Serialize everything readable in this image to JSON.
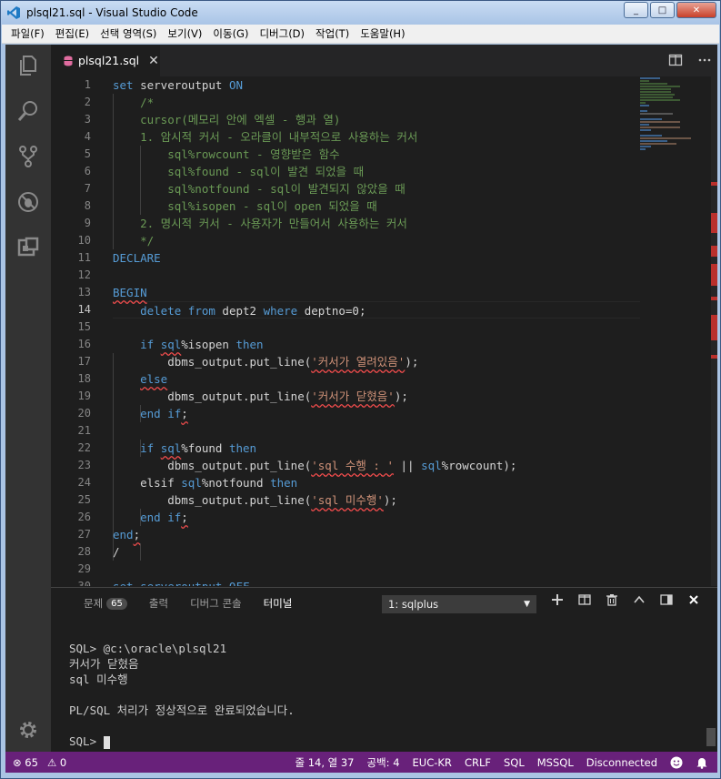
{
  "window": {
    "title": "plsql21.sql - Visual Studio Code",
    "minimize": "_",
    "maximize": "□",
    "close": "✕"
  },
  "menu": [
    "파일(F)",
    "편집(E)",
    "선택 영역(S)",
    "보기(V)",
    "이동(G)",
    "디버그(D)",
    "작업(T)",
    "도움말(H)"
  ],
  "tab": {
    "label": "plsql21.sql",
    "close": "✕"
  },
  "colors": {
    "statusbar": "#68217a",
    "keyword": "#569cd6",
    "comment": "#6a9955",
    "string": "#ce9178",
    "error": "#f14c4c"
  },
  "icons": [
    "explorer-icon",
    "search-icon",
    "source-control-icon",
    "debug-icon",
    "extensions-icon",
    "gear-icon"
  ],
  "line_numbers": [
    "1",
    "2",
    "3",
    "4",
    "5",
    "6",
    "7",
    "8",
    "9",
    "10",
    "11",
    "12",
    "13",
    "14",
    "15",
    "16",
    "17",
    "18",
    "19",
    "20",
    "21",
    "22",
    "23",
    "24",
    "25",
    "26",
    "27",
    "28",
    "29",
    "30"
  ],
  "code": [
    [
      {
        "t": "set ",
        "c": "kw"
      },
      {
        "t": "serveroutput "
      },
      {
        "t": "ON",
        "c": "kw"
      }
    ],
    [
      {
        "t": "    /*",
        "c": "cm"
      }
    ],
    [
      {
        "t": "    cursor(메모리 안에 엑셀 - 행과 열)",
        "c": "cm"
      }
    ],
    [
      {
        "t": "    1. 암시적 커서 - 오라클이 내부적으로 사용하는 커서",
        "c": "cm"
      }
    ],
    [
      {
        "t": "        sql%rowcount - 영향받은 함수",
        "c": "cm"
      }
    ],
    [
      {
        "t": "        sql%found - sql이 발견 되었을 때",
        "c": "cm"
      }
    ],
    [
      {
        "t": "        sql%notfound - sql이 발견되지 않았을 때",
        "c": "cm"
      }
    ],
    [
      {
        "t": "        sql%isopen - sql이 open 되었을 때",
        "c": "cm"
      }
    ],
    [
      {
        "t": "    2. 명시적 커서 - 사용자가 만들어서 사용하는 커서",
        "c": "cm"
      }
    ],
    [
      {
        "t": "    */",
        "c": "cm"
      }
    ],
    [
      {
        "t": "DECLARE",
        "c": "kw"
      }
    ],
    [
      {
        "t": ""
      }
    ],
    [
      {
        "t": "BEGIN",
        "c": "kw sq"
      }
    ],
    [
      {
        "t": "    "
      },
      {
        "t": "delete from ",
        "c": "kw"
      },
      {
        "t": "dept2 "
      },
      {
        "t": "where ",
        "c": "kw"
      },
      {
        "t": "deptno=0;"
      }
    ],
    [
      {
        "t": ""
      }
    ],
    [
      {
        "t": "    "
      },
      {
        "t": "if ",
        "c": "kw"
      },
      {
        "t": "sql",
        "c": "kw sq"
      },
      {
        "t": "%isopen "
      },
      {
        "t": "then",
        "c": "kw"
      }
    ],
    [
      {
        "t": "        dbms_output.put_line("
      },
      {
        "t": "'커서가 열려있음'",
        "c": "st sq"
      },
      {
        "t": ");"
      }
    ],
    [
      {
        "t": "    "
      },
      {
        "t": "else",
        "c": "kw sq"
      }
    ],
    [
      {
        "t": "        dbms_output.put_line("
      },
      {
        "t": "'커서가 닫혔음'",
        "c": "st sq"
      },
      {
        "t": ");"
      }
    ],
    [
      {
        "t": "    "
      },
      {
        "t": "end if",
        "c": "kw"
      },
      {
        "t": ";",
        "c": "sq"
      }
    ],
    [
      {
        "t": ""
      }
    ],
    [
      {
        "t": "    "
      },
      {
        "t": "if ",
        "c": "kw"
      },
      {
        "t": "sql",
        "c": "kw sq"
      },
      {
        "t": "%found "
      },
      {
        "t": "then",
        "c": "kw"
      }
    ],
    [
      {
        "t": "        dbms_output.put_line("
      },
      {
        "t": "'sql 수행 : '",
        "c": "st sq"
      },
      {
        "t": " || "
      },
      {
        "t": "sql",
        "c": "kw"
      },
      {
        "t": "%rowcount);"
      }
    ],
    [
      {
        "t": "    elsif "
      },
      {
        "t": "sql",
        "c": "kw"
      },
      {
        "t": "%notfound "
      },
      {
        "t": "then",
        "c": "kw"
      }
    ],
    [
      {
        "t": "        dbms_output.put_line("
      },
      {
        "t": "'sql 미수행'",
        "c": "st sq"
      },
      {
        "t": ");"
      }
    ],
    [
      {
        "t": "    "
      },
      {
        "t": "end if",
        "c": "kw"
      },
      {
        "t": ";",
        "c": "sq"
      }
    ],
    [
      {
        "t": "end",
        "c": "kw"
      },
      {
        "t": ";",
        "c": "sq"
      }
    ],
    [
      {
        "t": "/"
      }
    ],
    [
      {
        "t": ""
      }
    ],
    [
      {
        "t": "set serveroutput OFF",
        "c": "kw"
      }
    ]
  ],
  "panel": {
    "tabs": [
      {
        "label": "문제",
        "badge": "65"
      },
      {
        "label": "출력"
      },
      {
        "label": "디버그 콘솔"
      },
      {
        "label": "터미널"
      }
    ],
    "terminal_select": "1: sqlplus",
    "terminal_lines": [
      "SQL> @c:\\oracle\\plsql21",
      "커서가 닫혔음",
      "sql 미수행",
      "",
      "PL/SQL 처리가 정상적으로 완료되었습니다.",
      "",
      "SQL> "
    ]
  },
  "status": {
    "errors": "65",
    "warnings": "0",
    "position": "줄 14, 열 37",
    "indent": "공백: 4",
    "encoding": "EUC-KR",
    "eol": "CRLF",
    "language": "SQL",
    "dialect": "MSSQL",
    "connection": "Disconnected"
  }
}
